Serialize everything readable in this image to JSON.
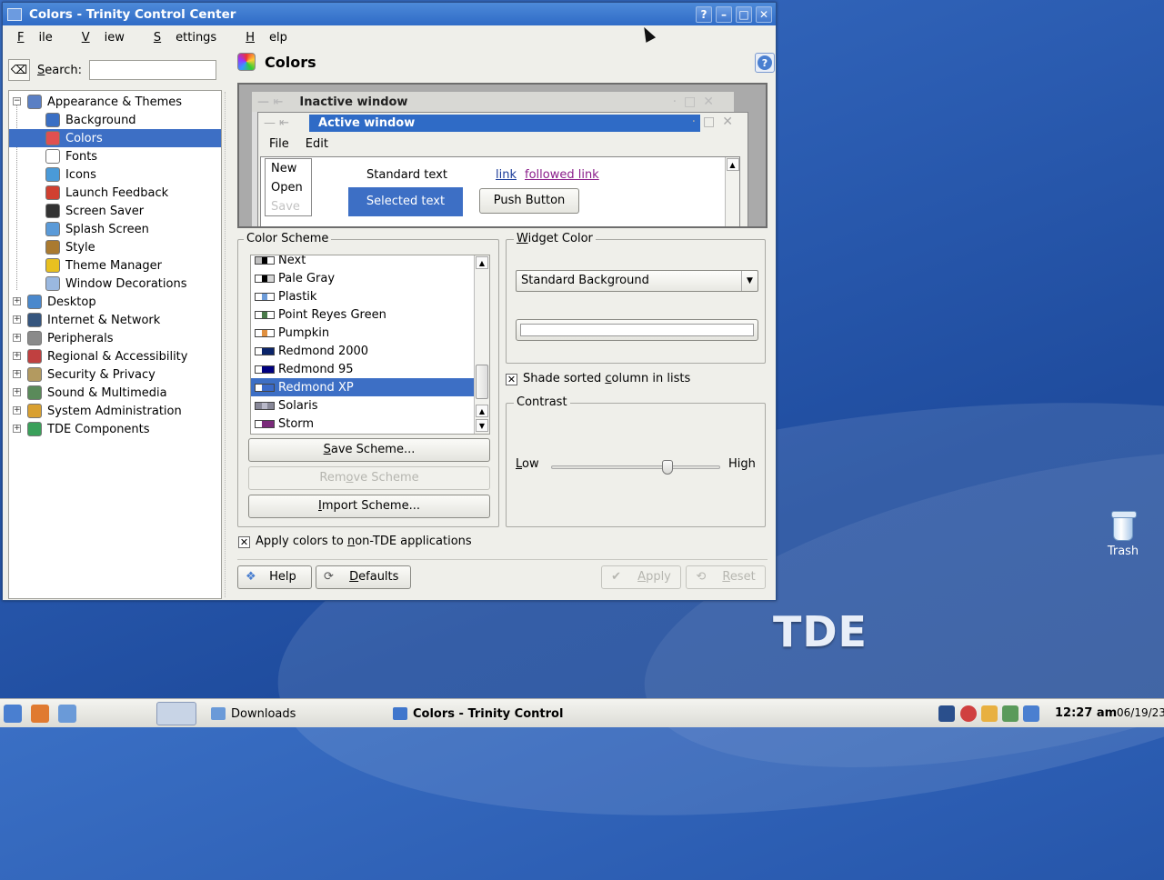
{
  "window": {
    "title": "Colors - Trinity Control Center"
  },
  "menubar": [
    {
      "label": "File",
      "mnemonic": "F",
      "rest": "ile"
    },
    {
      "label": "View",
      "mnemonic": "V",
      "rest": "iew"
    },
    {
      "label": "Settings",
      "mnemonic": "S",
      "rest": "ettings"
    },
    {
      "label": "Help",
      "mnemonic": "H",
      "rest": "elp"
    }
  ],
  "search": {
    "label_pre": "S",
    "label_rest": "earch:",
    "value": ""
  },
  "tree": {
    "parents": [
      {
        "label": "Appearance & Themes",
        "expanded": true,
        "color": "#5a7fc4"
      },
      {
        "label": "Desktop",
        "color": "#4a88cc"
      },
      {
        "label": "Internet & Network",
        "color": "#35557e"
      },
      {
        "label": "Peripherals",
        "color": "#8a8a8a"
      },
      {
        "label": "Regional & Accessibility",
        "color": "#c04040"
      },
      {
        "label": "Security & Privacy",
        "color": "#b39a60"
      },
      {
        "label": "Sound & Multimedia",
        "color": "#5a8a5a"
      },
      {
        "label": "System Administration",
        "color": "#d9a030"
      },
      {
        "label": "TDE Components",
        "color": "#3aa05a"
      }
    ],
    "children": [
      {
        "label": "Background",
        "color": "#3a6fc4"
      },
      {
        "label": "Colors",
        "color": "#e05050",
        "selected": true
      },
      {
        "label": "Fonts",
        "color": "#ffffff"
      },
      {
        "label": "Icons",
        "color": "#4a9ad8"
      },
      {
        "label": "Launch Feedback",
        "color": "#d04030"
      },
      {
        "label": "Screen Saver",
        "color": "#333333"
      },
      {
        "label": "Splash Screen",
        "color": "#5a9ad8"
      },
      {
        "label": "Style",
        "color": "#aa7a30"
      },
      {
        "label": "Theme Manager",
        "color": "#e8c020"
      },
      {
        "label": "Window Decorations",
        "color": "#9ab8e0"
      }
    ]
  },
  "content": {
    "title": "Colors"
  },
  "preview": {
    "inactive_title": "Inactive window",
    "active_title": "Active window",
    "menu": [
      "File",
      "Edit"
    ],
    "popup": [
      "New",
      "Open",
      "Save"
    ],
    "standard_text": "Standard text",
    "link": "link",
    "followed_link": "followed link",
    "selected_text": "Selected text",
    "push_button": "Push Button"
  },
  "color_scheme": {
    "title": "Color Scheme",
    "items": [
      {
        "label": "Next",
        "swatch": [
          "#c0c0c0",
          "#000000",
          "#ffffff"
        ]
      },
      {
        "label": "Pale Gray",
        "swatch": [
          "#ffffff",
          "#000000",
          "#d6d6d6"
        ]
      },
      {
        "label": "Plastik",
        "swatch": [
          "#ffffff",
          "#6c9bd8",
          "#ffffff"
        ]
      },
      {
        "label": "Point Reyes Green",
        "swatch": [
          "#ffffff",
          "#4a7a4a",
          "#ffffff"
        ]
      },
      {
        "label": "Pumpkin",
        "swatch": [
          "#ffffff",
          "#e09040",
          "#ffffff"
        ]
      },
      {
        "label": "Redmond 2000",
        "swatch": [
          "#ffffff",
          "#0a246a",
          "#0a246a"
        ]
      },
      {
        "label": "Redmond 95",
        "swatch": [
          "#ffffff",
          "#000080",
          "#000080"
        ]
      },
      {
        "label": "Redmond XP",
        "swatch": [
          "#ffffff",
          "#3a6ac8",
          "#3a6ac8"
        ],
        "selected": true
      },
      {
        "label": "Solaris",
        "swatch": [
          "#888898",
          "#b8b8c8",
          "#888898"
        ]
      },
      {
        "label": "Storm",
        "swatch": [
          "#ffffff",
          "#7a2a7a",
          "#7a2a7a"
        ]
      }
    ],
    "save_pre": "S",
    "save_rest": "ave Scheme...",
    "remove_pre": "Rem",
    "remove_mn": "o",
    "remove_rest": "ve Scheme",
    "import_pre": "I",
    "import_rest": "mport Scheme..."
  },
  "widget_color": {
    "title_pre": "W",
    "title_rest": "idget Color",
    "selected": "Standard Background",
    "value_color": "#ffffff"
  },
  "shade_sorted": {
    "checked": true,
    "pre": "Shade sorted ",
    "mn": "c",
    "rest": "olumn in lists"
  },
  "contrast": {
    "title": "Contrast",
    "low_mn": "L",
    "low_rest": "ow",
    "high": "High",
    "value": 0.7
  },
  "apply_nontde": {
    "checked": true,
    "pre": "Apply colors to ",
    "mn": "n",
    "rest": "on-TDE applications"
  },
  "buttons": {
    "help": "Help",
    "defaults_mn": "D",
    "defaults_rest": "efaults",
    "apply_mn": "A",
    "apply_rest": "pply",
    "reset_mn": "R",
    "reset_rest": "eset"
  },
  "desktop": {
    "trash": "Trash",
    "logo": "TDE"
  },
  "taskbar": {
    "tasks": [
      "Downloads",
      "Colors - Trinity Control"
    ],
    "time": "12:27 am",
    "date": "06/19/23"
  },
  "colors": {
    "accent": "#3d6fc5",
    "titlebar": "#2f6bc6"
  }
}
